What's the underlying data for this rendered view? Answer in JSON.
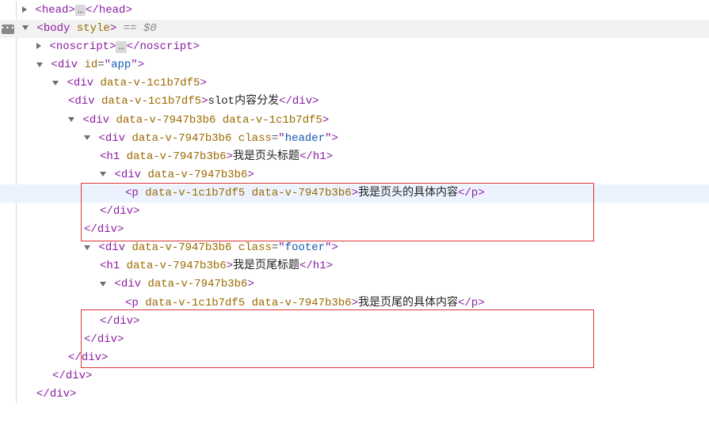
{
  "tree": {
    "head": {
      "tag": "head",
      "collapsed": true
    },
    "body": {
      "tag": "body",
      "attrs": [
        {
          "name": "style",
          "value": null
        }
      ],
      "trailing": "== $0"
    },
    "noscript": {
      "tag": "noscript",
      "collapsed": true
    },
    "app": {
      "tag": "div",
      "attrs": [
        {
          "name": "id",
          "value": "app"
        }
      ]
    },
    "outer": {
      "tag": "div",
      "attrs": [
        {
          "name": "data-v-1c1b7df5",
          "value": null
        }
      ]
    },
    "slot_line": {
      "tag": "div",
      "attrs": [
        {
          "name": "data-v-1c1b7df5",
          "value": null
        }
      ],
      "text": "slot内容分发"
    },
    "comp": {
      "tag": "div",
      "attrs": [
        {
          "name": "data-v-7947b3b6",
          "value": null
        },
        {
          "name": "data-v-1c1b7df5",
          "value": null
        }
      ]
    },
    "header": {
      "tag": "div",
      "attrs": [
        {
          "name": "data-v-7947b3b6",
          "value": null
        },
        {
          "name": "class",
          "value": "header"
        }
      ]
    },
    "h1_header": {
      "tag": "h1",
      "attrs": [
        {
          "name": "data-v-7947b3b6",
          "value": null
        }
      ],
      "text": "我是页头标题"
    },
    "header_inner": {
      "tag": "div",
      "attrs": [
        {
          "name": "data-v-7947b3b6",
          "value": null
        }
      ]
    },
    "p_header": {
      "tag": "p",
      "attrs": [
        {
          "name": "data-v-1c1b7df5",
          "value": null
        },
        {
          "name": "data-v-7947b3b6",
          "value": null
        }
      ],
      "text": "我是页头的具体内容"
    },
    "footer": {
      "tag": "div",
      "attrs": [
        {
          "name": "data-v-7947b3b6",
          "value": null
        },
        {
          "name": "class",
          "value": "footer"
        }
      ]
    },
    "h1_footer": {
      "tag": "h1",
      "attrs": [
        {
          "name": "data-v-7947b3b6",
          "value": null
        }
      ],
      "text": "我是页尾标题"
    },
    "footer_inner": {
      "tag": "div",
      "attrs": [
        {
          "name": "data-v-7947b3b6",
          "value": null
        }
      ]
    },
    "p_footer": {
      "tag": "p",
      "attrs": [
        {
          "name": "data-v-1c1b7df5",
          "value": null
        },
        {
          "name": "data-v-7947b3b6",
          "value": null
        }
      ],
      "text": "我是页尾的具体内容"
    },
    "close_div": "div"
  }
}
